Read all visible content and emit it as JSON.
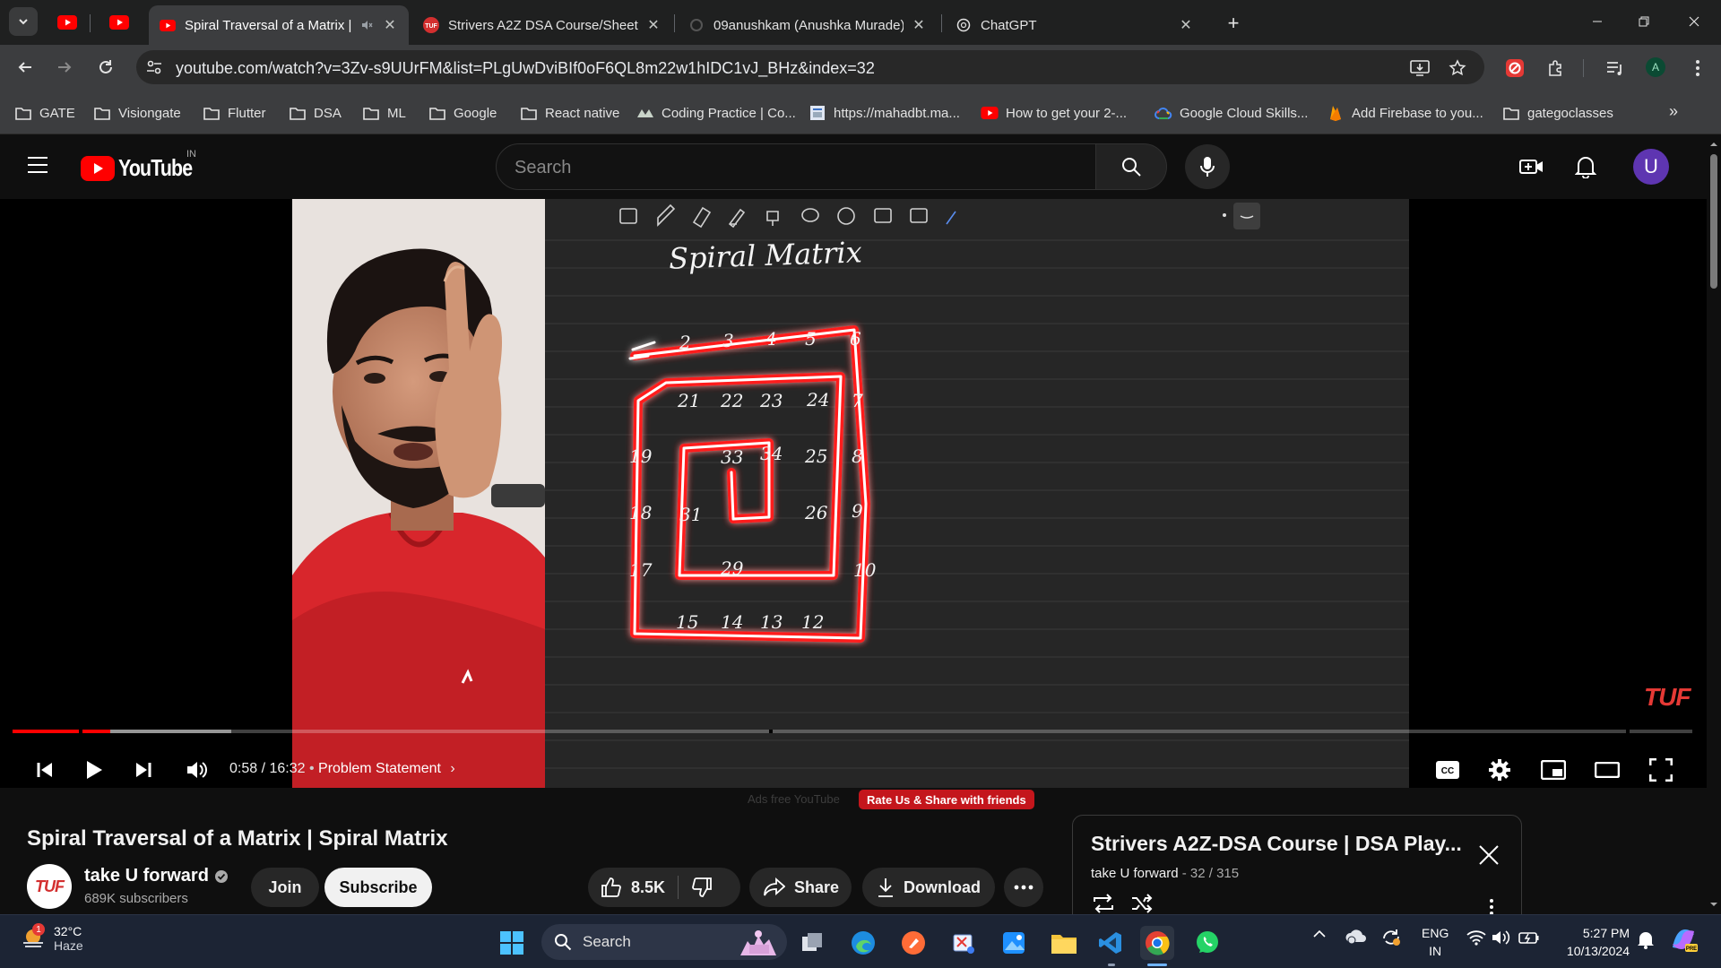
{
  "browser": {
    "tabs": [
      {
        "title": "Spiral Traversal of a Matrix | Spiral Matrix",
        "active": true
      },
      {
        "title": "Strivers A2Z DSA Course/Sheet",
        "active": false
      },
      {
        "title": "09anushkam (Anushka Murade)",
        "active": false
      },
      {
        "title": "ChatGPT",
        "active": false
      }
    ],
    "url": "youtube.com/watch?v=3Zv-s9UUrFM&list=PLgUwDviBIf0oF6QL8m22w1hIDC1vJ_BHz&index=32",
    "profile_initial": "A",
    "bookmarks": [
      "GATE",
      "Visiongate",
      "Flutter",
      "DSA",
      "ML",
      "Google",
      "React native",
      "Coding Practice | Co...",
      "https://mahadbt.ma...",
      "How to get your 2-...",
      "Google Cloud Skills...",
      "Add Firebase to you...",
      "gategoclasses"
    ]
  },
  "youtube": {
    "logo_text": "YouTube",
    "country_code": "IN",
    "search_placeholder": "Search",
    "user_initial": "U",
    "accent_color": "#ff0000"
  },
  "player": {
    "board_title": "Spiral Matrix",
    "watermark": "TUF",
    "time_current": "0:58",
    "time_total": "16:32",
    "time_display": "0:58 / 16:32",
    "chapter": "Problem Statement",
    "progress_played_fraction": 0.058,
    "progress_buffered_fraction": 0.13,
    "matrix_numbers": [
      "2",
      "3",
      "4",
      "5",
      "6",
      "21",
      "22",
      "23",
      "24",
      "7",
      "19",
      "33",
      "34",
      "25",
      "8",
      "18",
      "31",
      "26",
      "9",
      "17",
      "29",
      "10",
      "15",
      "14",
      "13",
      "12"
    ]
  },
  "below_player": {
    "ads_text": "Ads free YouTube",
    "rate_share": "Rate Us & Share with friends"
  },
  "video": {
    "title": "Spiral Traversal of a Matrix | Spiral Matrix",
    "channel_name": "take U forward",
    "channel_avatar_text": "TUF",
    "subscribers": "689K subscribers",
    "join_label": "Join",
    "subscribe_label": "Subscribe",
    "likes": "8.5K",
    "share_label": "Share",
    "download_label": "Download"
  },
  "playlist": {
    "title": "Strivers A2Z-DSA Course | DSA Play...",
    "channel": "take U forward",
    "position": "32 / 315"
  },
  "taskbar": {
    "weather_temp": "32°C",
    "weather_condition": "Haze",
    "weather_badge": "1",
    "search_label": "Search",
    "lang_line1": "ENG",
    "lang_line2": "IN",
    "time": "5:27 PM",
    "date": "10/13/2024"
  }
}
